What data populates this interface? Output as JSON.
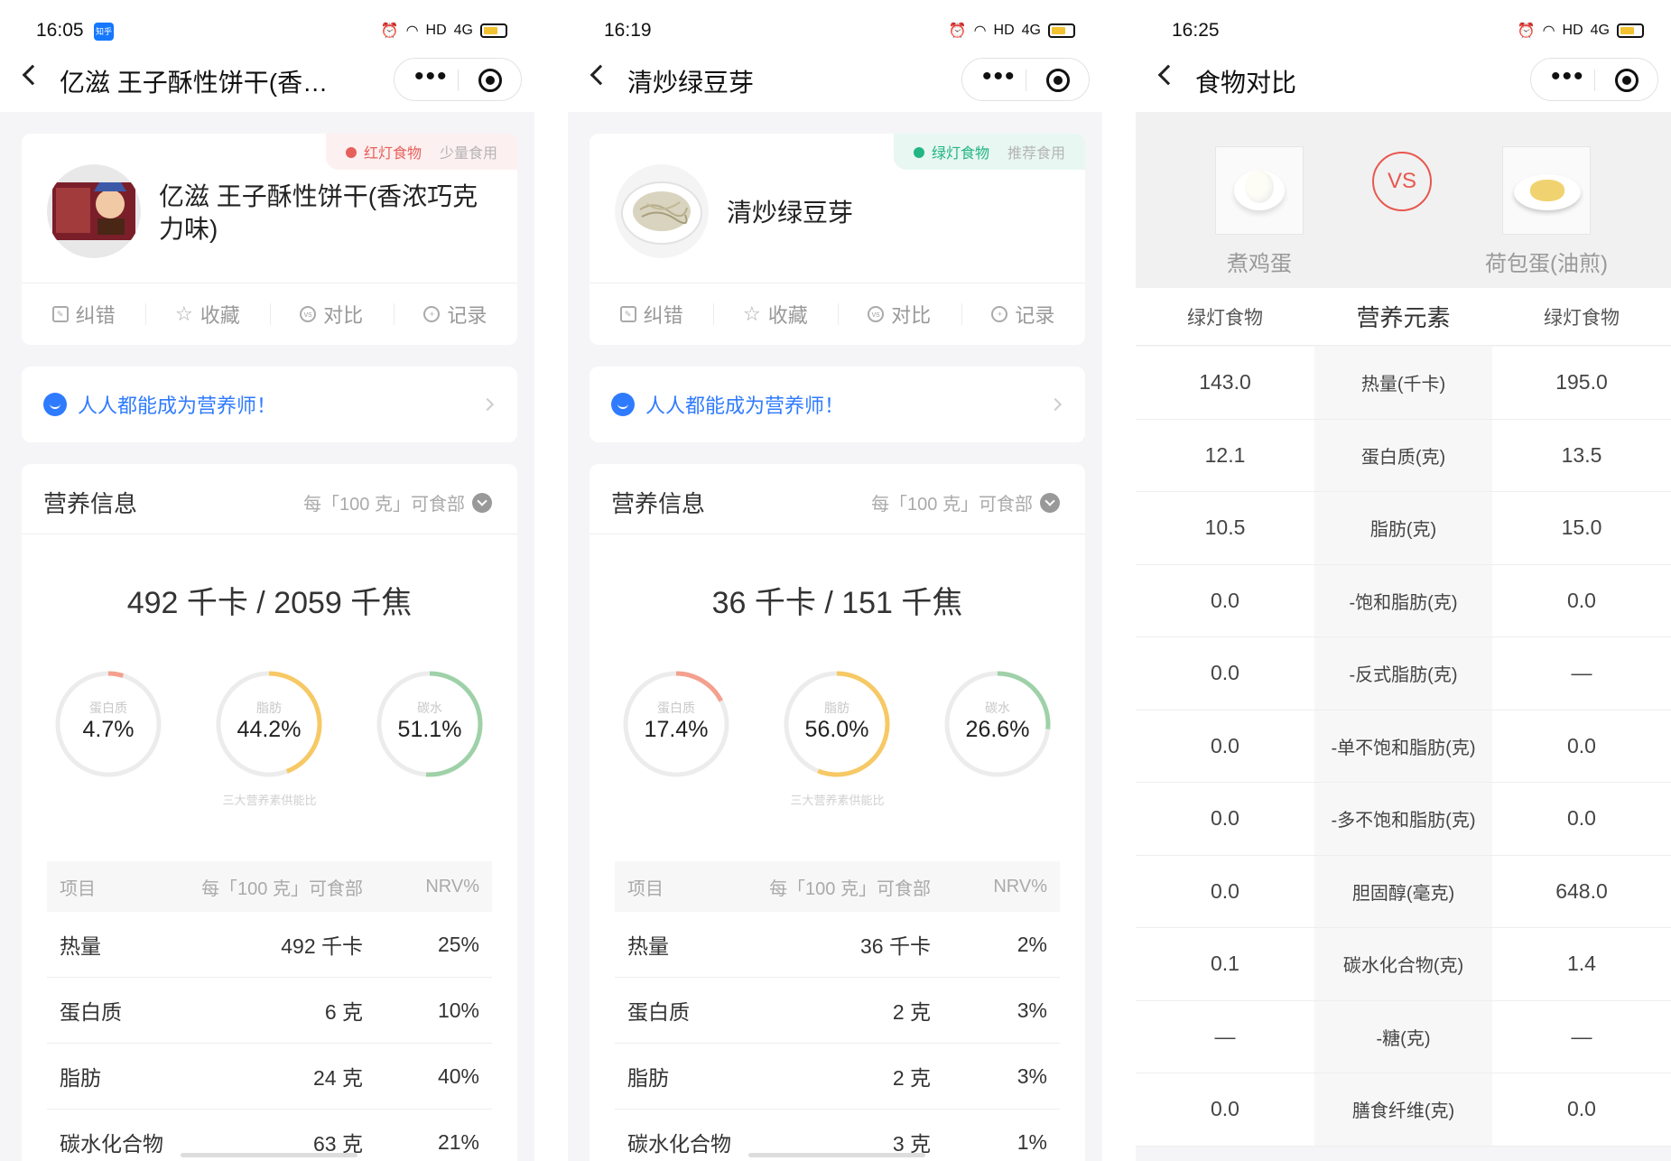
{
  "status_bar": {
    "hd": "HD",
    "signal": "4G"
  },
  "capsule": {
    "more": "•••"
  },
  "screens": [
    {
      "time": "16:05",
      "app_badge": "知乎",
      "nav_title": "亿滋 王子酥性饼干(香浓...",
      "tag_type": "红灯食物",
      "tag_advice": "少量食用",
      "food_name": "亿滋 王子酥性饼干(香浓巧克力味)",
      "actions": [
        "纠错",
        "收藏",
        "对比",
        "记录"
      ],
      "banner": "人人都能成为营养师！",
      "nutrition_title": "营养信息",
      "per_unit": "每「100 克」可食部",
      "energy": "492 千卡 / 2059 千焦",
      "ratios": [
        {
          "label": "蛋白质",
          "value": "4.7%",
          "fraction": 0.047,
          "color": "#f4a08e"
        },
        {
          "label": "脂肪",
          "value": "44.2%",
          "fraction": 0.442,
          "color": "#f7c965"
        },
        {
          "label": "碳水",
          "value": "51.1%",
          "fraction": 0.511,
          "color": "#9fd1a8"
        }
      ],
      "ratio_caption": "三大营养素供能比",
      "table_head": [
        "项目",
        "每「100 克」可食部",
        "NRV%"
      ],
      "table_rows": [
        [
          "热量",
          "492 千卡",
          "25%"
        ],
        [
          "蛋白质",
          "6 克",
          "10%"
        ],
        [
          "脂肪",
          "24 克",
          "40%"
        ],
        [
          "碳水化合物",
          "63 克",
          "21%"
        ]
      ]
    },
    {
      "time": "16:19",
      "nav_title": "清炒绿豆芽",
      "tag_type": "绿灯食物",
      "tag_advice": "推荐食用",
      "food_name": "清炒绿豆芽",
      "actions": [
        "纠错",
        "收藏",
        "对比",
        "记录"
      ],
      "banner": "人人都能成为营养师！",
      "nutrition_title": "营养信息",
      "per_unit": "每「100 克」可食部",
      "energy": "36 千卡 / 151 千焦",
      "ratios": [
        {
          "label": "蛋白质",
          "value": "17.4%",
          "fraction": 0.174,
          "color": "#f4a08e"
        },
        {
          "label": "脂肪",
          "value": "56.0%",
          "fraction": 0.56,
          "color": "#f7c965"
        },
        {
          "label": "碳水",
          "value": "26.6%",
          "fraction": 0.266,
          "color": "#9fd1a8"
        }
      ],
      "ratio_caption": "三大营养素供能比",
      "table_head": [
        "项目",
        "每「100 克」可食部",
        "NRV%"
      ],
      "table_rows": [
        [
          "热量",
          "36 千卡",
          "2%"
        ],
        [
          "蛋白质",
          "2 克",
          "3%"
        ],
        [
          "脂肪",
          "2 克",
          "3%"
        ],
        [
          "碳水化合物",
          "3 克",
          "1%"
        ]
      ]
    }
  ],
  "compare": {
    "time": "16:25",
    "nav_title": "食物对比",
    "vs": "VS",
    "left_food": "煮鸡蛋",
    "right_food": "荷包蛋(油煎)",
    "head": [
      "绿灯食物",
      "营养元素",
      "绿灯食物"
    ],
    "rows": [
      [
        "143.0",
        "热量(千卡)",
        "195.0"
      ],
      [
        "12.1",
        "蛋白质(克)",
        "13.5"
      ],
      [
        "10.5",
        "脂肪(克)",
        "15.0"
      ],
      [
        "0.0",
        "-饱和脂肪(克)",
        "0.0"
      ],
      [
        "0.0",
        "-反式脂肪(克)",
        "—"
      ],
      [
        "0.0",
        "-单不饱和脂肪(克)",
        "0.0"
      ],
      [
        "0.0",
        "-多不饱和脂肪(克)",
        "0.0"
      ],
      [
        "0.0",
        "胆固醇(毫克)",
        "648.0"
      ],
      [
        "0.1",
        "碳水化合物(克)",
        "1.4"
      ],
      [
        "—",
        "-糖(克)",
        "—"
      ],
      [
        "0.0",
        "膳食纤维(克)",
        "0.0"
      ]
    ]
  }
}
